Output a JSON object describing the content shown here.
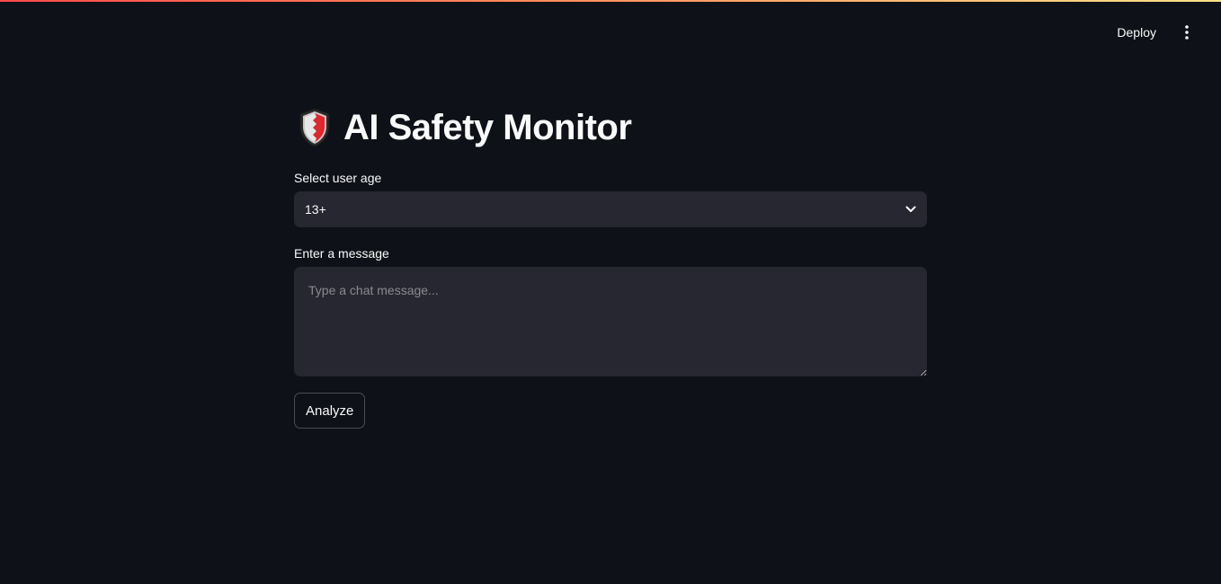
{
  "header": {
    "deploy_label": "Deploy",
    "menu_icon": "vertical-ellipsis-icon"
  },
  "main": {
    "title": "AI Safety Monitor",
    "title_icon": "shield-icon",
    "age_select": {
      "label": "Select user age",
      "value": "13+"
    },
    "message": {
      "label": "Enter a message",
      "placeholder": "Type a chat message...",
      "value": ""
    },
    "analyze_label": "Analyze"
  },
  "colors": {
    "background": "#0e1117",
    "input_bg": "#262730",
    "accent_red": "#ff4b4b",
    "accent_yellow": "#ffe38a"
  }
}
